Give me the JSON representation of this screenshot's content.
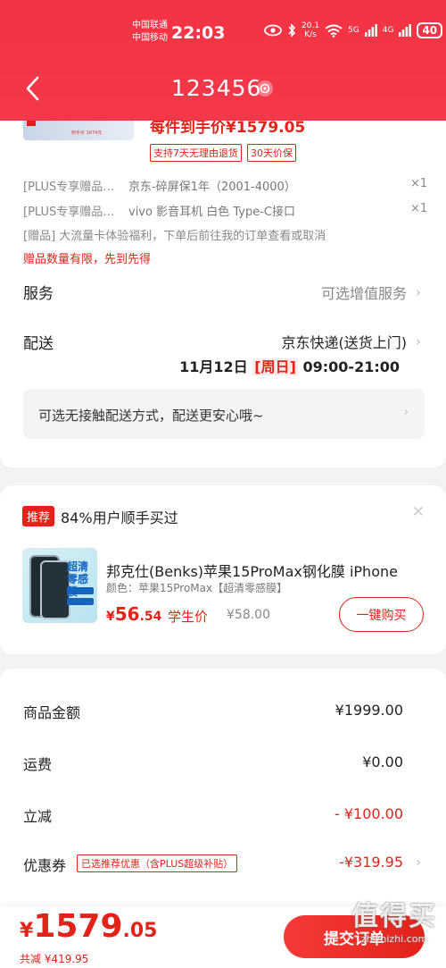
{
  "status": {
    "carrier_top": "中国联通",
    "carrier_bottom": "中国移动",
    "time": "22:03",
    "speed_value": "20.1",
    "speed_unit": "K/s",
    "net1": "5G",
    "net2": "4G",
    "battery": "40"
  },
  "header": {
    "title": "123456",
    "accent": "#f23343"
  },
  "product": {
    "thumb_text": "SERIES",
    "thumb_price": "到手价 1674元",
    "promo_price": "每件到手价¥1579.05",
    "tags": [
      "支持7天无理由退货",
      "30天价保"
    ]
  },
  "gifts": [
    {
      "type": "[PLUS专享赠品…",
      "name": "京东-碎屏保1年（2001-4000）",
      "qty": "×1"
    },
    {
      "type": "[PLUS专享赠品…",
      "name": "vivo 影音耳机 白色 Type-C接口",
      "qty": "×1"
    }
  ],
  "gift_note": "[赠品] 大流量卡体验福利，下单后前往我的订单查看或取消",
  "gift_warn": "赠品数量有限，先到先得",
  "service": {
    "label": "服务",
    "value": "可选增值服务"
  },
  "delivery": {
    "label": "配送",
    "method": "京东快递(送货上门)",
    "date": "11月12日",
    "weekday": "[周日]",
    "window": "09:00-21:00",
    "contactless": "可选无接触配送方式，配送更安心哦~"
  },
  "recommend": {
    "badge": "推荐",
    "title": "84%用户顺手买过",
    "name": "邦克仕(Benks)苹果15ProMax钢化膜 iPhone",
    "spec": "颜色：苹果15ProMax【超清零感膜】",
    "price_yen": "¥",
    "price_int": "56",
    "price_dec": ".54",
    "price_label": "学生价",
    "orig_price": "¥58.00",
    "buy": "一键购买",
    "img_text": "超清\n零感膜"
  },
  "summary": [
    {
      "label": "商品金额",
      "value": "¥1999.00",
      "red": false
    },
    {
      "label": "运费",
      "value": "¥0.00",
      "red": false
    },
    {
      "label": "立减",
      "value": "- ¥100.00",
      "red": true
    },
    {
      "label": "优惠券",
      "value": "-¥319.95",
      "red": true
    }
  ],
  "coupon_tag": "已选推荐优惠（含PLUS超级补贴）",
  "bottom": {
    "yen": "¥",
    "total_int": "1579",
    "total_dec": ".05",
    "saved": "共减 ¥419.95",
    "submit": "提交订单"
  },
  "watermark": {
    "big": "值得买",
    "small": "zhizhizhi.com"
  }
}
